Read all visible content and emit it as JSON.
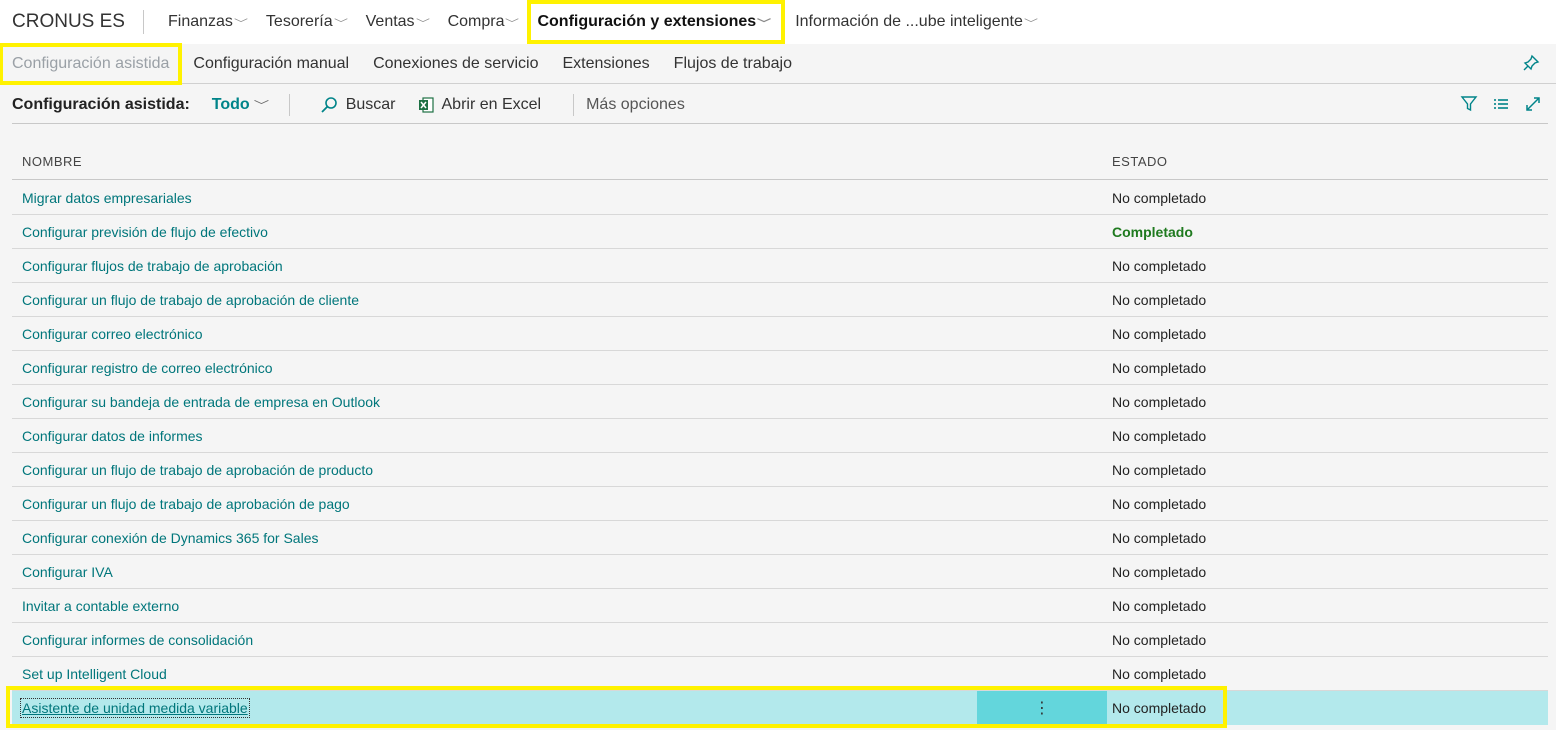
{
  "brand": "CRONUS ES",
  "nav": {
    "items": [
      {
        "label": "Finanzas"
      },
      {
        "label": "Tesorería"
      },
      {
        "label": "Ventas"
      },
      {
        "label": "Compra"
      },
      {
        "label": "Configuración y extensiones"
      },
      {
        "label": "Información de ...ube inteligente"
      }
    ]
  },
  "subnav": {
    "items": [
      {
        "label": "Configuración asistida"
      },
      {
        "label": "Configuración manual"
      },
      {
        "label": "Conexiones de servicio"
      },
      {
        "label": "Extensiones"
      },
      {
        "label": "Flujos de trabajo"
      }
    ]
  },
  "actionbar": {
    "title": "Configuración asistida:",
    "filter": "Todo",
    "search_label": "Buscar",
    "excel_label": "Abrir en Excel",
    "more_label": "Más opciones"
  },
  "grid": {
    "columns": {
      "name": "NOMBRE",
      "status": "ESTADO"
    },
    "rows": [
      {
        "name": "Migrar datos empresariales",
        "status": "No completado"
      },
      {
        "name": "Configurar previsión de flujo de efectivo",
        "status": "Completado"
      },
      {
        "name": "Configurar flujos de trabajo de aprobación",
        "status": "No completado"
      },
      {
        "name": "Configurar un flujo de trabajo de aprobación de cliente",
        "status": "No completado"
      },
      {
        "name": "Configurar correo electrónico",
        "status": "No completado"
      },
      {
        "name": "Configurar registro de correo electrónico",
        "status": "No completado"
      },
      {
        "name": "Configurar su bandeja de entrada de empresa en Outlook",
        "status": "No completado"
      },
      {
        "name": "Configurar datos de informes",
        "status": "No completado"
      },
      {
        "name": "Configurar un flujo de trabajo de aprobación de producto",
        "status": "No completado"
      },
      {
        "name": "Configurar un flujo de trabajo de aprobación de pago",
        "status": "No completado"
      },
      {
        "name": "Configurar conexión de Dynamics 365 for Sales",
        "status": "No completado"
      },
      {
        "name": "Configurar IVA",
        "status": "No completado"
      },
      {
        "name": "Invitar a contable externo",
        "status": "No completado"
      },
      {
        "name": "Configurar informes de consolidación",
        "status": "No completado"
      },
      {
        "name": "Set up Intelligent Cloud",
        "status": "No completado"
      },
      {
        "name": "Asistente de unidad medida variable",
        "status": "No completado"
      }
    ],
    "row_menu_glyph": "⋮"
  },
  "colors": {
    "accent": "#008489",
    "selected_row": "#b3e9ec",
    "highlight": "#fff200",
    "completed": "#1f7a1f"
  }
}
